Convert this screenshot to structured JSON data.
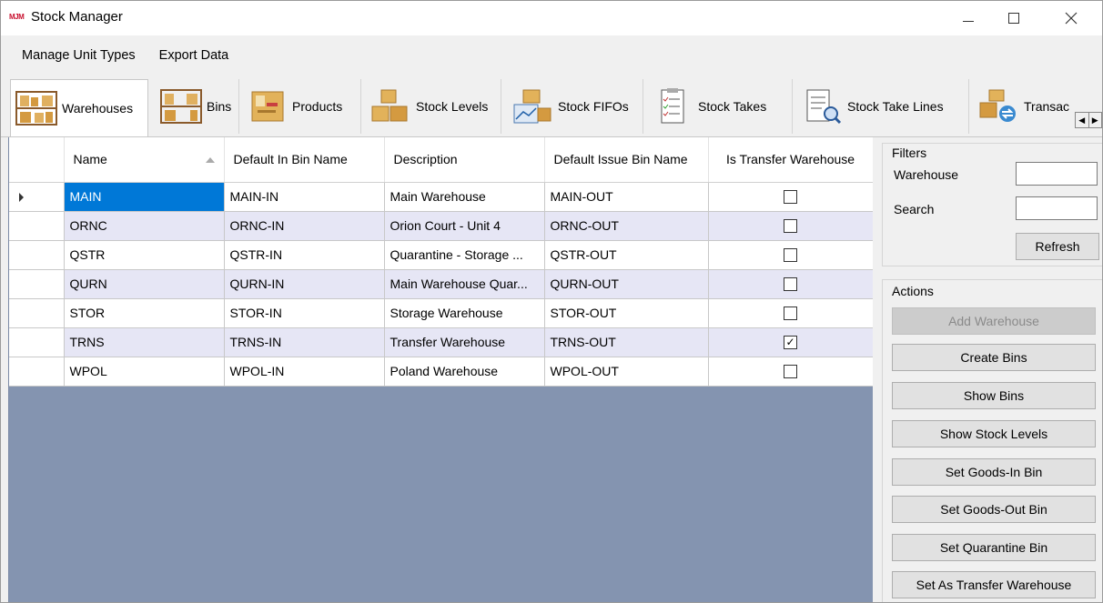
{
  "window": {
    "title": "Stock Manager",
    "logo_text": "MJM"
  },
  "menu": {
    "items": [
      {
        "label": "Manage Unit Types"
      },
      {
        "label": "Export Data"
      }
    ]
  },
  "tabs": [
    {
      "label": "Warehouses",
      "icon": "shelves-icon",
      "active": true
    },
    {
      "label": "Bins",
      "icon": "shelves-icon"
    },
    {
      "label": "Products",
      "icon": "product-box-icon"
    },
    {
      "label": "Stock Levels",
      "icon": "boxes-icon"
    },
    {
      "label": "Stock FIFOs",
      "icon": "box-chart-icon"
    },
    {
      "label": "Stock Takes",
      "icon": "checklist-icon"
    },
    {
      "label": "Stock Take Lines",
      "icon": "checklist-search-icon"
    },
    {
      "label": "Transac",
      "icon": "boxes-transfer-icon"
    }
  ],
  "grid": {
    "columns": [
      {
        "label": "Name",
        "sorted": "asc"
      },
      {
        "label": "Default In Bin Name"
      },
      {
        "label": "Description"
      },
      {
        "label": "Default Issue Bin Name"
      },
      {
        "label": "Is Transfer Warehouse"
      }
    ],
    "rows": [
      {
        "name": "MAIN",
        "in_bin": "MAIN-IN",
        "description": "Main Warehouse",
        "issue_bin": "MAIN-OUT",
        "transfer": false,
        "selected": true
      },
      {
        "name": "ORNC",
        "in_bin": "ORNC-IN",
        "description": "Orion Court - Unit 4",
        "issue_bin": "ORNC-OUT",
        "transfer": false
      },
      {
        "name": "QSTR",
        "in_bin": "QSTR-IN",
        "description": "Quarantine - Storage ...",
        "issue_bin": "QSTR-OUT",
        "transfer": false
      },
      {
        "name": "QURN",
        "in_bin": "QURN-IN",
        "description": "Main Warehouse Quar...",
        "issue_bin": "QURN-OUT",
        "transfer": false
      },
      {
        "name": "STOR",
        "in_bin": "STOR-IN",
        "description": "Storage Warehouse",
        "issue_bin": "STOR-OUT",
        "transfer": false
      },
      {
        "name": "TRNS",
        "in_bin": "TRNS-IN",
        "description": "Transfer Warehouse",
        "issue_bin": "TRNS-OUT",
        "transfer": true
      },
      {
        "name": "WPOL",
        "in_bin": "WPOL-IN",
        "description": "Poland Warehouse",
        "issue_bin": "WPOL-OUT",
        "transfer": false
      }
    ]
  },
  "filters": {
    "title": "Filters",
    "warehouse_label": "Warehouse",
    "warehouse_value": "",
    "search_label": "Search",
    "search_value": "",
    "refresh_label": "Refresh"
  },
  "actions": {
    "title": "Actions",
    "buttons": [
      {
        "label": "Add Warehouse",
        "enabled": false
      },
      {
        "label": "Create Bins",
        "enabled": true
      },
      {
        "label": "Show Bins",
        "enabled": true
      },
      {
        "label": "Show Stock Levels",
        "enabled": true
      },
      {
        "label": "Set Goods-In Bin",
        "enabled": true
      },
      {
        "label": "Set Goods-Out Bin",
        "enabled": true
      },
      {
        "label": "Set Quarantine Bin",
        "enabled": true
      },
      {
        "label": "Set As Transfer Warehouse",
        "enabled": true
      }
    ]
  },
  "colors": {
    "selection": "#0078d7",
    "alt_row": "#e6e6f5",
    "grid_background": "#8494b0",
    "logo": "#c8102e"
  }
}
